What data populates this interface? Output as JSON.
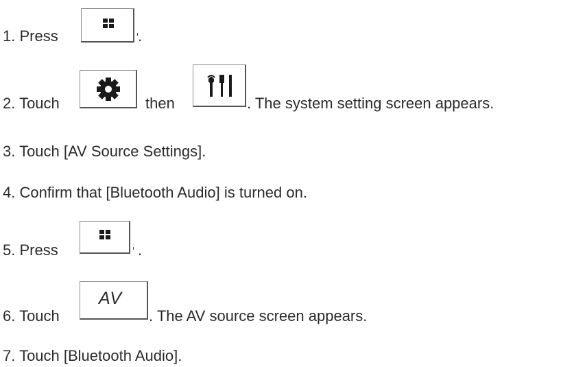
{
  "steps": [
    {
      "prefix": "1. Press",
      "suffix": ".",
      "icon": "home-grid-icon"
    },
    {
      "prefix": "2. Touch",
      "middle": "then",
      "suffix": ". The system setting screen appears.",
      "icon1": "gear-icon",
      "icon2": "tools-icon"
    },
    {
      "text": "3. Touch [AV Source Settings]."
    },
    {
      "text": "4. Confirm that [Bluetooth Audio] is turned on."
    },
    {
      "prefix": "5. Press",
      "suffix": ".",
      "icon": "home-grid-icon"
    },
    {
      "prefix": "6. Touch",
      "suffix": ". The AV source screen appears.",
      "icon": "av-button-icon",
      "icon_label": "AV"
    },
    {
      "text": "7. Touch [Bluetooth Audio]."
    }
  ]
}
